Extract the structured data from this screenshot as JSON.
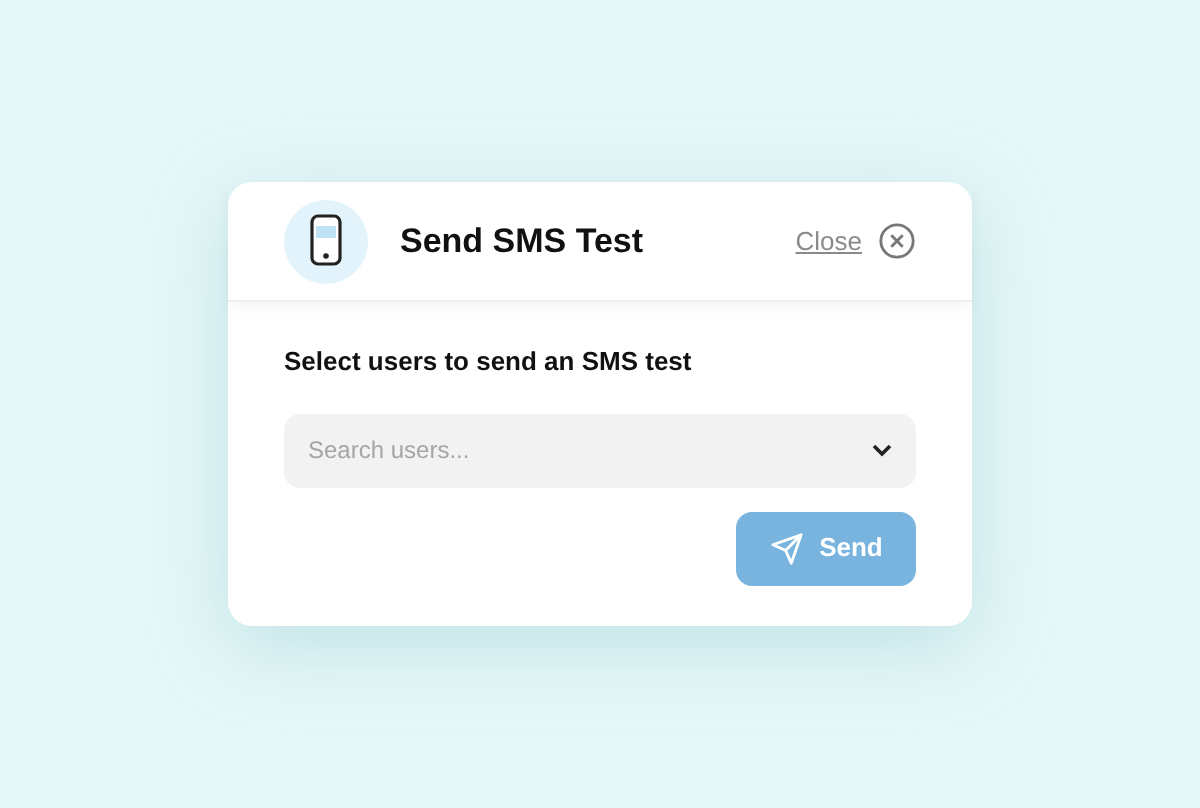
{
  "dialog": {
    "title": "Send SMS Test",
    "close_label": "Close"
  },
  "prompt": "Select users to send an SMS test",
  "search": {
    "placeholder": "Search users..."
  },
  "send_button": {
    "label": "Send",
    "disabled": true
  }
}
